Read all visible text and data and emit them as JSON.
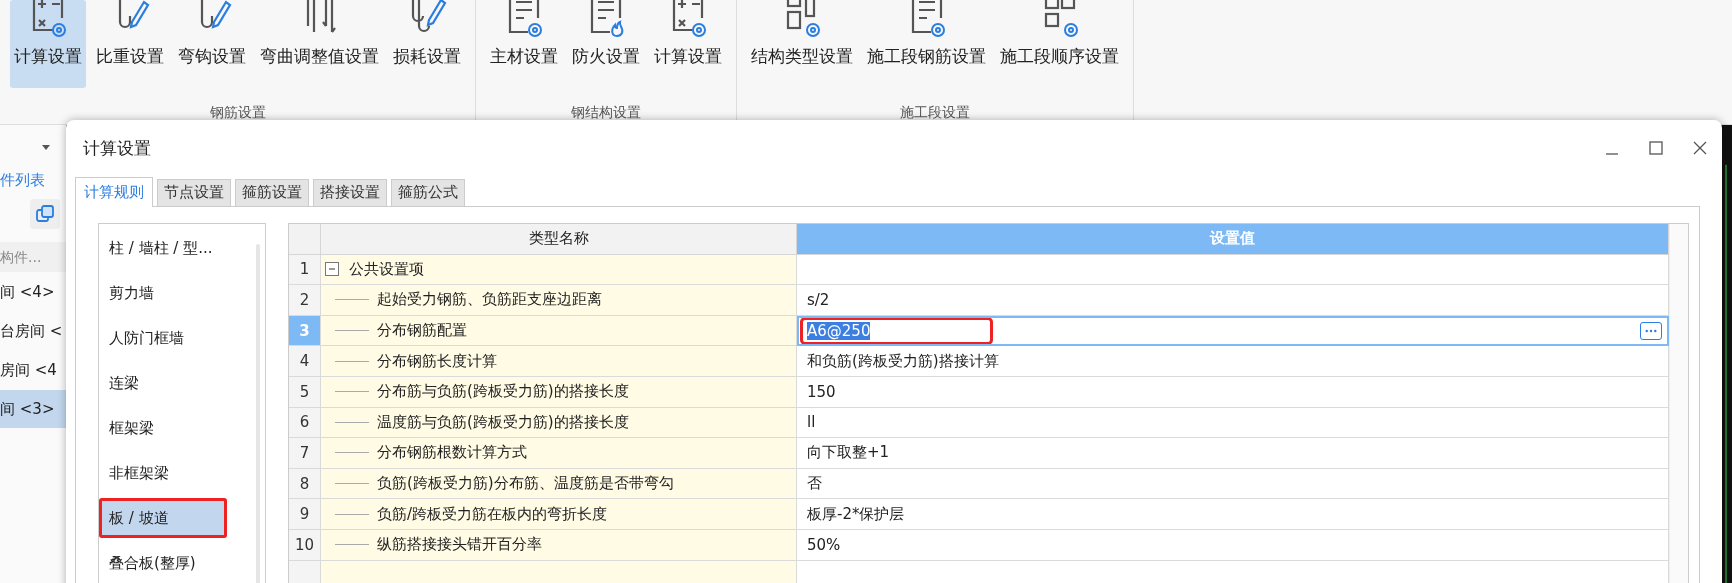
{
  "ribbon": {
    "groups": [
      {
        "label": "钢筋设置",
        "buttons": [
          {
            "label": "计算设置",
            "kind": "calc",
            "selected": true
          },
          {
            "label": "比重设置",
            "kind": "weight",
            "selected": false
          },
          {
            "label": "弯钩设置",
            "kind": "hook",
            "selected": false
          },
          {
            "label": "弯曲调整值设置",
            "kind": "bend",
            "selected": false
          },
          {
            "label": "损耗设置",
            "kind": "loss",
            "selected": false
          }
        ]
      },
      {
        "label": "钢结构设置",
        "buttons": [
          {
            "label": "主材设置",
            "kind": "material",
            "selected": false
          },
          {
            "label": "防火设置",
            "kind": "fire",
            "selected": false
          },
          {
            "label": "计算设置",
            "kind": "calc",
            "selected": false
          }
        ]
      },
      {
        "label": "施工段设置",
        "buttons": [
          {
            "label": "结构类型设置",
            "kind": "structure",
            "selected": false
          },
          {
            "label": "施工段钢筋设置",
            "kind": "stage",
            "selected": false
          },
          {
            "label": "施工段顺序设置",
            "kind": "order",
            "selected": false
          }
        ]
      }
    ]
  },
  "left_panel": {
    "tab_label": "件列表",
    "search_placeholder": "构件...",
    "items": [
      {
        "label": "间 <4>",
        "selected": false
      },
      {
        "label": "台房间 <",
        "selected": false
      },
      {
        "label": "房间 <4",
        "selected": false
      },
      {
        "label": "间 <3>",
        "selected": true
      }
    ]
  },
  "dialog": {
    "title": "计算设置",
    "tabs": [
      {
        "label": "计算规则",
        "selected": true
      },
      {
        "label": "节点设置",
        "selected": false
      },
      {
        "label": "箍筋设置",
        "selected": false
      },
      {
        "label": "搭接设置",
        "selected": false
      },
      {
        "label": "箍筋公式",
        "selected": false
      }
    ],
    "categories": [
      {
        "label": "柱 / 墙柱 / 型...",
        "selected": false,
        "highlighted": false
      },
      {
        "label": "剪力墙",
        "selected": false,
        "highlighted": false
      },
      {
        "label": "人防门框墙",
        "selected": false,
        "highlighted": false
      },
      {
        "label": "连梁",
        "selected": false,
        "highlighted": false
      },
      {
        "label": "框架梁",
        "selected": false,
        "highlighted": false
      },
      {
        "label": "非框架梁",
        "selected": false,
        "highlighted": false
      },
      {
        "label": "板 / 坡道",
        "selected": true,
        "highlighted": true
      },
      {
        "label": "叠合板(整厚)",
        "selected": false,
        "highlighted": false
      }
    ],
    "table": {
      "columns": [
        "类型名称",
        "设置值"
      ],
      "rows": [
        {
          "number": "1",
          "name": "公共设置项",
          "expanded": true,
          "selected": false,
          "children": [
            {
              "number": "2",
              "name": "起始受力钢筋、负筋距支座边距离",
              "value": "s/2",
              "selected": false,
              "highlighted": false
            },
            {
              "number": "3",
              "name": "分布钢筋配置",
              "value": "A6@250",
              "selected": true,
              "highlighted": true
            },
            {
              "number": "4",
              "name": "分布钢筋长度计算",
              "value": "和负筋(跨板受力筋)搭接计算",
              "selected": false,
              "highlighted": false
            },
            {
              "number": "5",
              "name": "分布筋与负筋(跨板受力筋)的搭接长度",
              "value": "150",
              "selected": false,
              "highlighted": false
            },
            {
              "number": "6",
              "name": "温度筋与负筋(跨板受力筋)的搭接长度",
              "value": "ll",
              "selected": false,
              "highlighted": false
            },
            {
              "number": "7",
              "name": "分布钢筋根数计算方式",
              "value": "向下取整+1",
              "selected": false,
              "highlighted": false
            },
            {
              "number": "8",
              "name": "负筋(跨板受力筋)分布筋、温度筋是否带弯勾",
              "value": "否",
              "selected": false,
              "highlighted": false
            },
            {
              "number": "9",
              "name": "负筋/跨板受力筋在板内的弯折长度",
              "value": "板厚-2*保护层",
              "selected": false,
              "highlighted": false
            },
            {
              "number": "10",
              "name": "纵筋搭接接头错开百分率",
              "value": "50%",
              "selected": false,
              "highlighted": false
            }
          ]
        }
      ]
    }
  }
}
